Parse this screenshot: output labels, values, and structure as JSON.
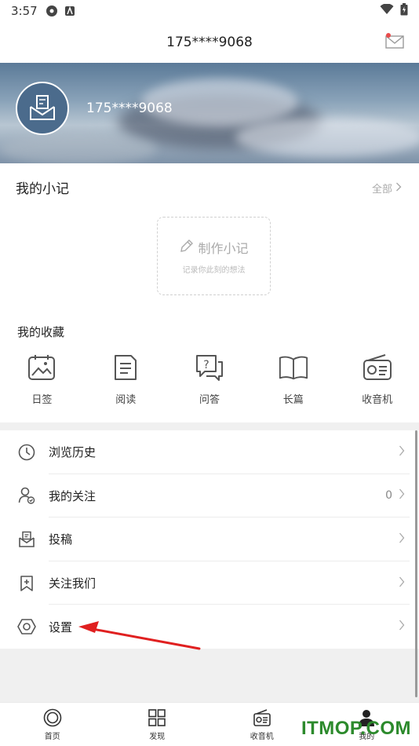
{
  "status_bar": {
    "time": "3:57"
  },
  "header": {
    "title": "175****9068"
  },
  "profile": {
    "username": "175****9068"
  },
  "notes": {
    "title": "我的小记",
    "all_label": "全部",
    "make_label": "制作小记",
    "make_hint": "记录你此刻的想法"
  },
  "favorites": {
    "title": "我的收藏",
    "items": [
      {
        "label": "日签",
        "icon": "calendar-image-icon"
      },
      {
        "label": "阅读",
        "icon": "document-icon"
      },
      {
        "label": "问答",
        "icon": "question-chat-icon"
      },
      {
        "label": "长篇",
        "icon": "book-icon"
      },
      {
        "label": "收音机",
        "icon": "radio-icon"
      }
    ]
  },
  "menu": [
    {
      "label": "浏览历史",
      "icon": "clock-icon",
      "value": ""
    },
    {
      "label": "我的关注",
      "icon": "user-follow-icon",
      "value": "0"
    },
    {
      "label": "投稿",
      "icon": "submit-box-icon",
      "value": ""
    },
    {
      "label": "关注我们",
      "icon": "bookmark-plus-icon",
      "value": ""
    },
    {
      "label": "设置",
      "icon": "hexagon-settings-icon",
      "value": ""
    }
  ],
  "tabbar": [
    {
      "label": "首页",
      "icon": "home-circle-icon"
    },
    {
      "label": "发现",
      "icon": "grid-icon"
    },
    {
      "label": "收音机",
      "icon": "radio-icon"
    },
    {
      "label": "我的",
      "icon": "person-icon"
    }
  ],
  "watermark": "ITMOP.COM",
  "colors": {
    "annotation_arrow": "#e02020",
    "watermark": "#2c8a2c"
  }
}
